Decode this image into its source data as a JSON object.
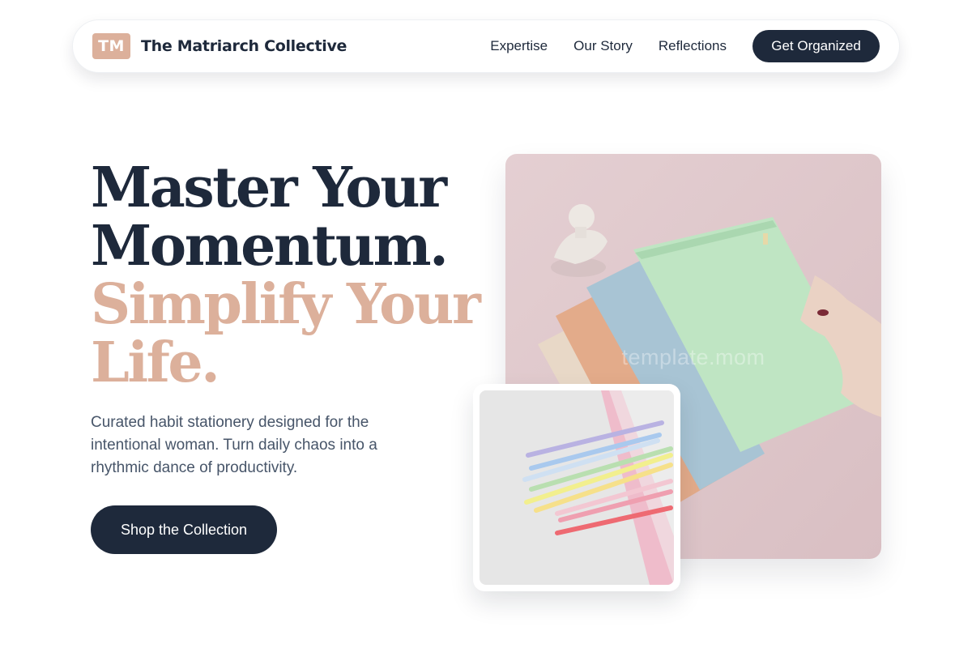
{
  "nav": {
    "logo_mark": "TM",
    "brand_name": "The Matriarch Collective",
    "links": [
      {
        "label": "Expertise"
      },
      {
        "label": "Our Story"
      },
      {
        "label": "Reflections"
      }
    ],
    "cta_label": "Get Organized"
  },
  "hero": {
    "headline_line1": "Master Your",
    "headline_line2": "Momentum.",
    "headline_accent1": "Simplify Your",
    "headline_accent2": "Life.",
    "subcopy": "Curated habit stationery designed for the intentional woman. Turn daily chaos into a rhythmic dance of productivity.",
    "button_label": "Shop the Collection"
  },
  "images": {
    "main_watermark": "template.mom"
  },
  "colors": {
    "navy": "#1e293b",
    "accent": "#dcb09b",
    "body_text": "#475569"
  }
}
